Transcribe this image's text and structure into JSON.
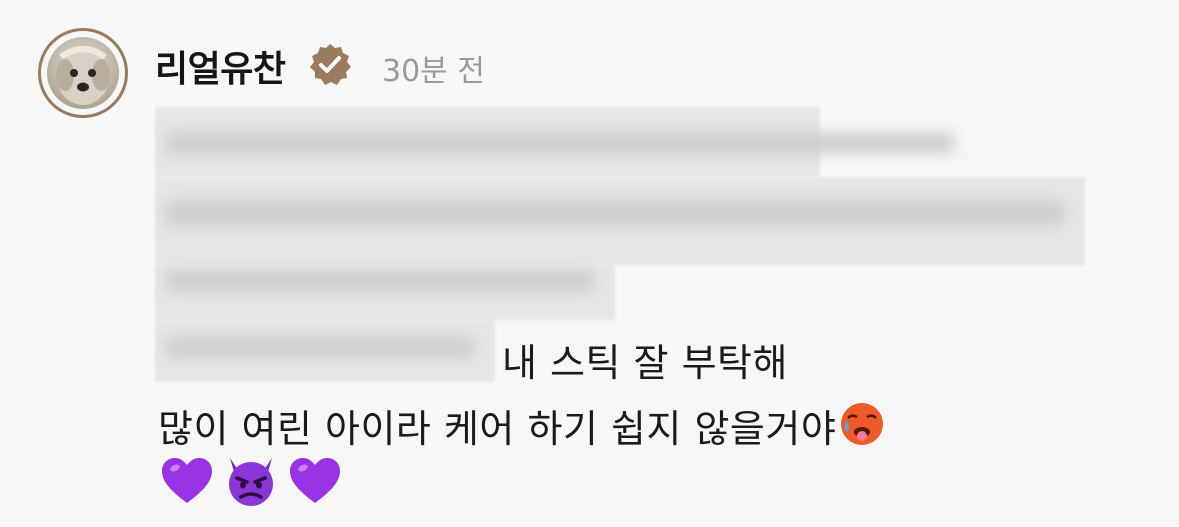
{
  "comment": {
    "username": "리얼유찬",
    "time_ago": "30분 전",
    "line_1": "내 스틱 잘 부탁해",
    "line_2": "많이 여린 아이라 케어 하기 쉽지 않을거야",
    "line_2_emoji": "🥵",
    "reaction_emojis": [
      "💜",
      "👿",
      "💜"
    ]
  },
  "colors": {
    "avatar_ring": "#9b7b5e",
    "verified_badge": "#9b7b5e",
    "heart": "#9a33e6",
    "devil": "#7a2bbf",
    "time_text": "#9a9a9a"
  }
}
